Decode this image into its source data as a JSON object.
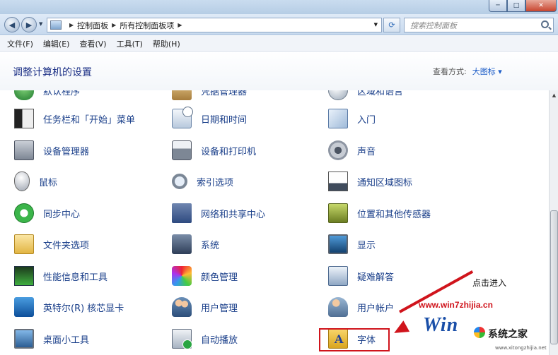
{
  "window": {
    "min_label": "─",
    "max_label": "□",
    "close_label": "✕"
  },
  "address": {
    "back_icon": "◀",
    "fwd_icon": "▶",
    "crumbs": [
      "控制面板",
      "所有控制面板项"
    ],
    "separator": "▶",
    "drop_icon": "▼",
    "refresh_icon": "⟳",
    "search_placeholder": "搜索控制面板"
  },
  "menu": [
    "文件(F)",
    "编辑(E)",
    "查看(V)",
    "工具(T)",
    "帮助(H)"
  ],
  "header": {
    "title": "调整计算机的设置",
    "view_by_label": "查看方式:",
    "view_by_value": "大图标 ▾"
  },
  "items": {
    "c0": [
      "默认程序",
      "任务栏和「开始」菜单",
      "设备管理器",
      "鼠标",
      "同步中心",
      "文件夹选项",
      "性能信息和工具",
      "英特尔(R) 核芯显卡",
      "桌面小工具"
    ],
    "c1": [
      "凭据管理器",
      "日期和时间",
      "设备和打印机",
      "索引选项",
      "网络和共享中心",
      "系统",
      "颜色管理",
      "用户管理",
      "自动播放"
    ],
    "c2": [
      "区域和语言",
      "入门",
      "声音",
      "通知区域图标",
      "位置和其他传感器",
      "显示",
      "疑难解答",
      "用户帐户",
      "字体"
    ]
  },
  "annotation": {
    "text": "点击进入"
  },
  "watermark": {
    "url": "www.win7zhijia.cn",
    "logo": "Win",
    "site": "系统之家",
    "small": "www.xitongzhijia.net"
  },
  "scrollbar": {
    "up_icon": "▲"
  }
}
